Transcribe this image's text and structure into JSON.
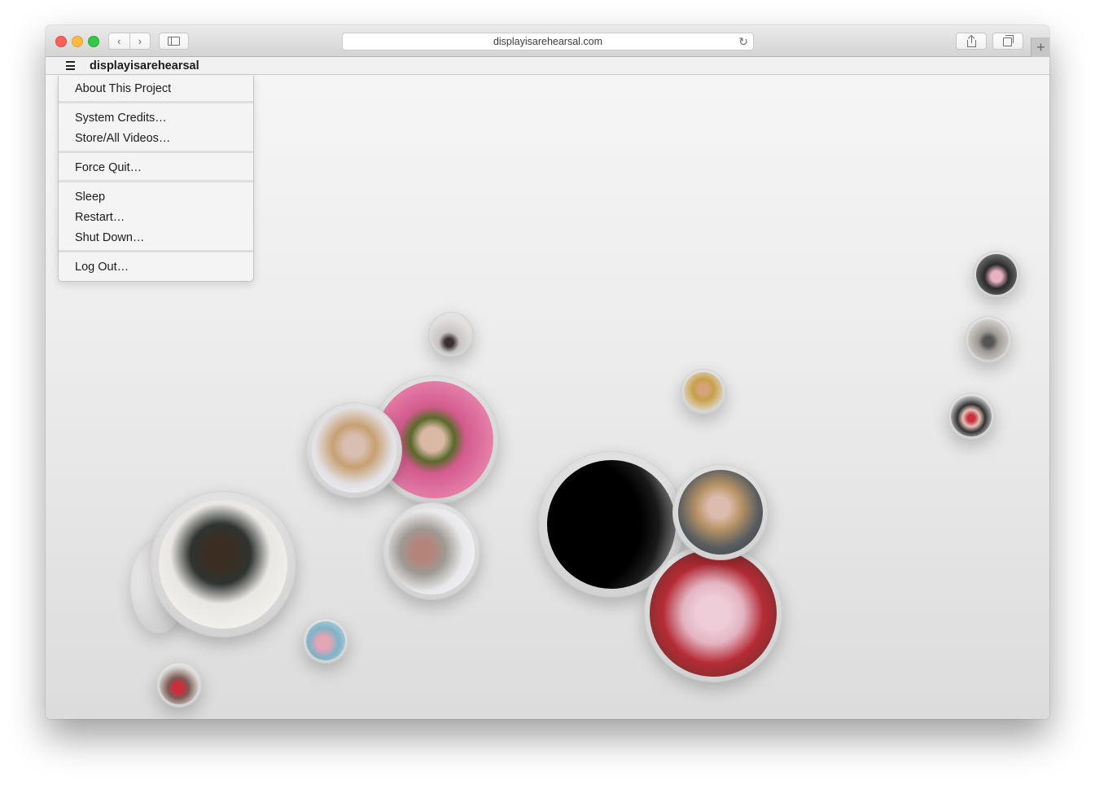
{
  "browser": {
    "url": "displayisarehearsal.com",
    "nav_back": "‹",
    "nav_forward": "›",
    "reload_glyph": "↻",
    "new_tab_glyph": "+"
  },
  "site": {
    "title": "displayisarehearsal"
  },
  "menu": {
    "groups": [
      [
        "About This Project"
      ],
      [
        "System Credits…",
        "Store/All Videos…"
      ],
      [
        "Force Quit…"
      ],
      [
        "Sleep",
        "Restart…",
        "Shut Down…"
      ],
      [
        "Log Out…"
      ]
    ]
  },
  "colors": {
    "close": "#fc605c",
    "minimize": "#fdbc40",
    "zoom": "#34c84a"
  }
}
